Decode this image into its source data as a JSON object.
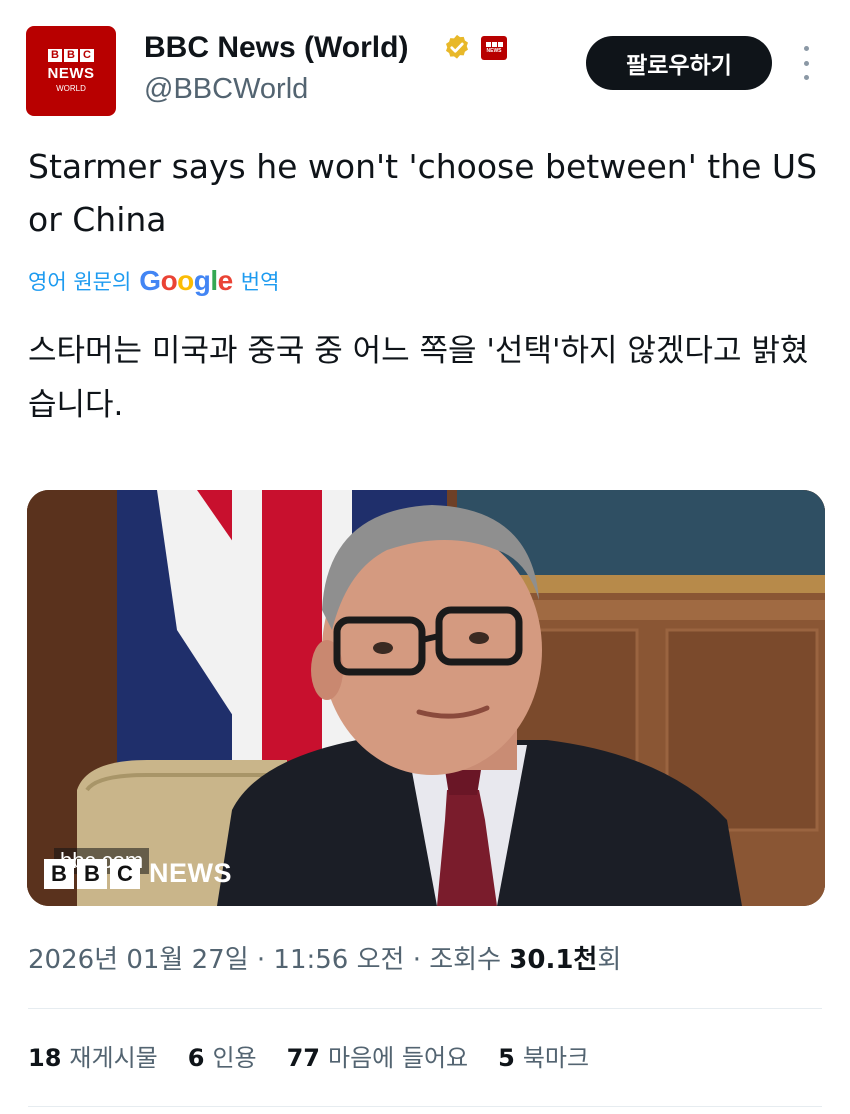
{
  "account": {
    "display_name": "BBC News (World)",
    "handle": "@BBCWorld",
    "avatar_blocks": [
      "B",
      "B",
      "C"
    ],
    "avatar_line1": "NEWS",
    "avatar_line2": "WORLD",
    "affiliate_text": "NEWS",
    "verified_icon": "gold-checkmark-icon",
    "verified_color": "#e8b829"
  },
  "actions": {
    "follow_label": "팔로우하기",
    "more_icon": "vertical-ellipsis-icon"
  },
  "tweet": {
    "text": "Starmer says he won't 'choose between' the US or China",
    "translate_prefix": "영어 원문의",
    "translate_brand": "Google",
    "translate_suffix": "번역",
    "translated_text": "스타머는 미국과 중국 중 어느 쪽을 '선택'하지 않겠다고 밝혔습니다."
  },
  "media": {
    "watermark_url": "bbc.com",
    "logo_blocks": [
      "B",
      "B",
      "C"
    ],
    "logo_text": "NEWS"
  },
  "meta": {
    "timestamp": "2026년 01월 27일 · 11:56 오전 · 조회수",
    "views_value": "30.1천",
    "views_suffix": "회"
  },
  "stats": [
    {
      "count": "18",
      "label": "재게시물"
    },
    {
      "count": "6",
      "label": "인용"
    },
    {
      "count": "77",
      "label": "마음에 들어요"
    },
    {
      "count": "5",
      "label": "북마크"
    }
  ],
  "colors": {
    "bbc_red": "#b80000",
    "link_blue": "#1d9bf0",
    "text_primary": "#0f1419",
    "text_secondary": "#536471"
  }
}
